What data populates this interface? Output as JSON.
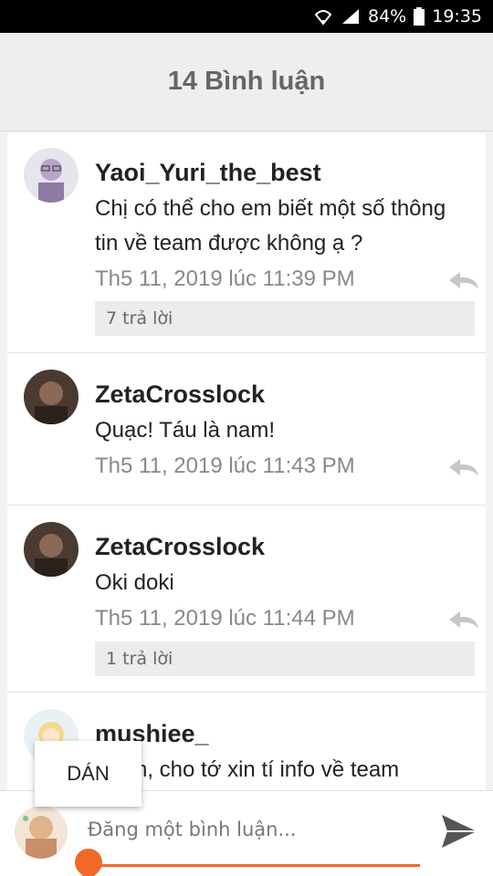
{
  "status": {
    "battery": "84%",
    "time": "19:35"
  },
  "header": {
    "title": "14 Bình luận"
  },
  "comments": [
    {
      "name": "Yaoi_Yuri_the_best",
      "text": "Chị có thể cho em biết một số thông tin về team được không ạ ?",
      "time": "Th5 11, 2019 lúc 11:39 PM",
      "replies": "7 trả lời"
    },
    {
      "name": "ZetaCrosslock",
      "text": "Quạc! Táu là nam!",
      "time": "Th5 11, 2019 lúc 11:43 PM"
    },
    {
      "name": "ZetaCrosslock",
      "text": "Oki doki",
      "time": "Th5 11, 2019 lúc 11:44 PM",
      "replies": "1 trả lời"
    },
    {
      "name": "mushiee_",
      "text": "Hmm, cho tớ xin tí info về team"
    }
  ],
  "context_menu": {
    "paste": "DÁN"
  },
  "composer": {
    "placeholder": "Đăng một bình luận..."
  },
  "colors": {
    "accent": "#f06a2a"
  }
}
